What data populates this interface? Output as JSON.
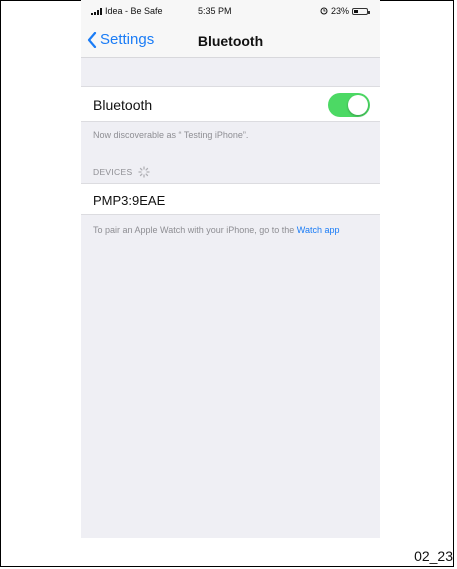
{
  "statusbar": {
    "carrier": "Idea - Be Safe",
    "time": "5:35 PM",
    "battery": "23%"
  },
  "navbar": {
    "back_label": "Settings",
    "title": "Bluetooth"
  },
  "bluetooth": {
    "label": "Bluetooth",
    "enabled": true,
    "discoverable_note": "Now discoverable as “ Testing iPhone”."
  },
  "devices": {
    "header": "DEVICES",
    "items": [
      {
        "name": "PMP3:9EAE"
      }
    ]
  },
  "watch_note": {
    "text": "To pair an Apple Watch with your iPhone, go to the ",
    "link": "Watch app"
  },
  "caption": "02_23",
  "colors": {
    "accent": "#1a7cf6",
    "toggle_on": "#4cd964",
    "background": "#efeff4"
  }
}
